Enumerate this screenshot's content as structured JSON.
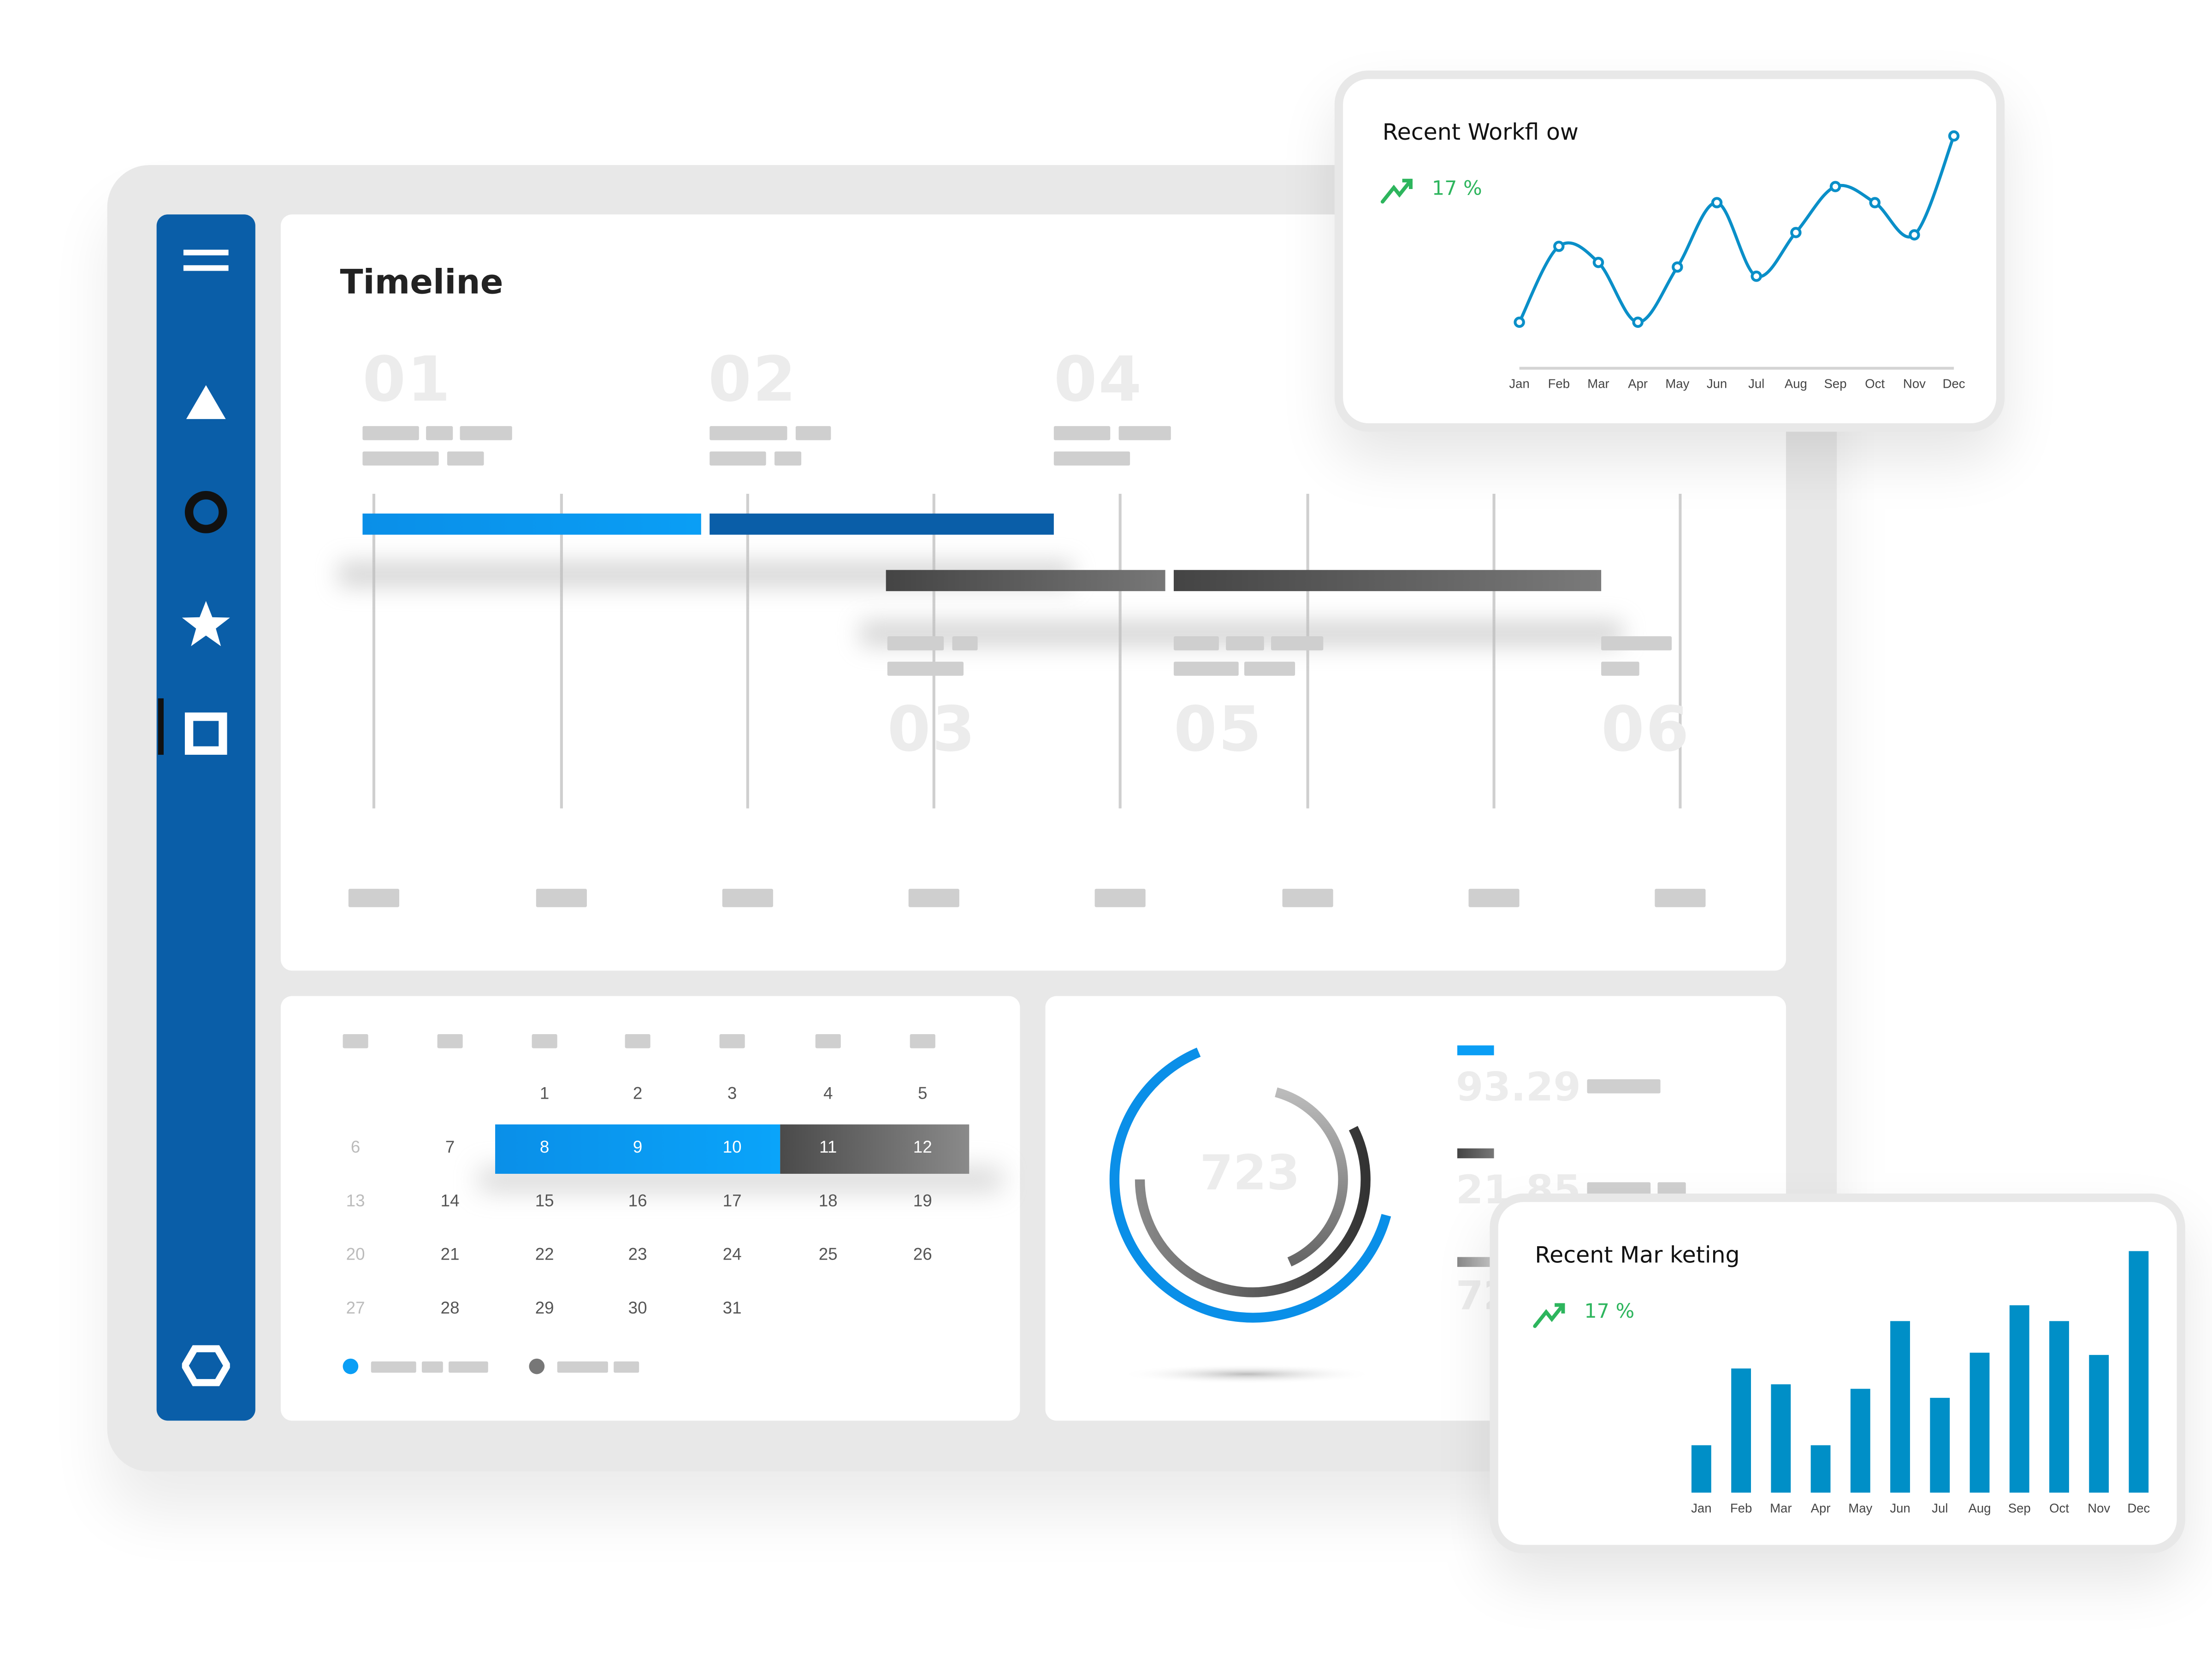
{
  "sidebar": {
    "items": [
      {
        "icon": "menu-icon"
      },
      {
        "icon": "triangle-icon"
      },
      {
        "icon": "circle-icon",
        "active": true
      },
      {
        "icon": "star-icon"
      },
      {
        "icon": "square-icon"
      },
      {
        "icon": "hexagon-icon"
      }
    ],
    "color": "#0a5ea8"
  },
  "timeline": {
    "title": "Timeline",
    "milestones_top": [
      "01",
      "02",
      "04"
    ],
    "milestones_bottom": [
      "03",
      "05",
      "06"
    ],
    "colors": {
      "blue_light": "#0a8fe8",
      "blue_dark": "#0a5ea8",
      "gray_dark": "#555555"
    }
  },
  "calendar": {
    "weeks": [
      [
        "",
        "",
        "1",
        "2",
        "3",
        "4",
        "5"
      ],
      [
        "6",
        "7",
        "8",
        "9",
        "10",
        "11",
        "12"
      ],
      [
        "13",
        "14",
        "15",
        "16",
        "17",
        "18",
        "19"
      ],
      [
        "20",
        "21",
        "22",
        "23",
        "24",
        "25",
        "26"
      ],
      [
        "27",
        "28",
        "29",
        "30",
        "31",
        "",
        ""
      ]
    ],
    "highlighted_blue": [
      "8",
      "9",
      "10"
    ],
    "highlighted_gray": [
      "11",
      "12"
    ]
  },
  "donut": {
    "center_value": "723",
    "stats": [
      "93.29",
      "21.85",
      "72"
    ],
    "colors": {
      "outer": "#0a8fe8",
      "middle": "#555555",
      "inner": "#b0b0b0"
    }
  },
  "workflow": {
    "title": "Recent  Workfl ow",
    "trend_icon": "trending-up-icon",
    "change": "17 %",
    "chart_data": {
      "type": "line",
      "categories": [
        "Jan",
        "Feb",
        "Mar",
        "Apr",
        "May",
        "Jun",
        "Jul",
        "Aug",
        "Sep",
        "Oct",
        "Nov",
        "Dec"
      ],
      "values": [
        20,
        53,
        46,
        20,
        44,
        72,
        40,
        59,
        79,
        72,
        58,
        101
      ],
      "ylim": [
        0,
        105
      ],
      "color": "#0a8fc8",
      "grid": false,
      "smooth": true,
      "markers": true
    }
  },
  "marketing": {
    "title": "Recent Mar  keting",
    "trend_icon": "trending-up-icon",
    "change": "17 %",
    "chart_data": {
      "type": "bar",
      "categories": [
        "Jan",
        "Feb",
        "Mar",
        "Apr",
        "May",
        "Jun",
        "Jul",
        "Aug",
        "Sep",
        "Oct",
        "Nov",
        "Dec"
      ],
      "values": [
        21,
        55,
        48,
        21,
        46,
        76,
        42,
        62,
        83,
        76,
        61,
        107
      ],
      "ylim": [
        0,
        110
      ],
      "color": "#008fc7",
      "grid": false
    }
  }
}
